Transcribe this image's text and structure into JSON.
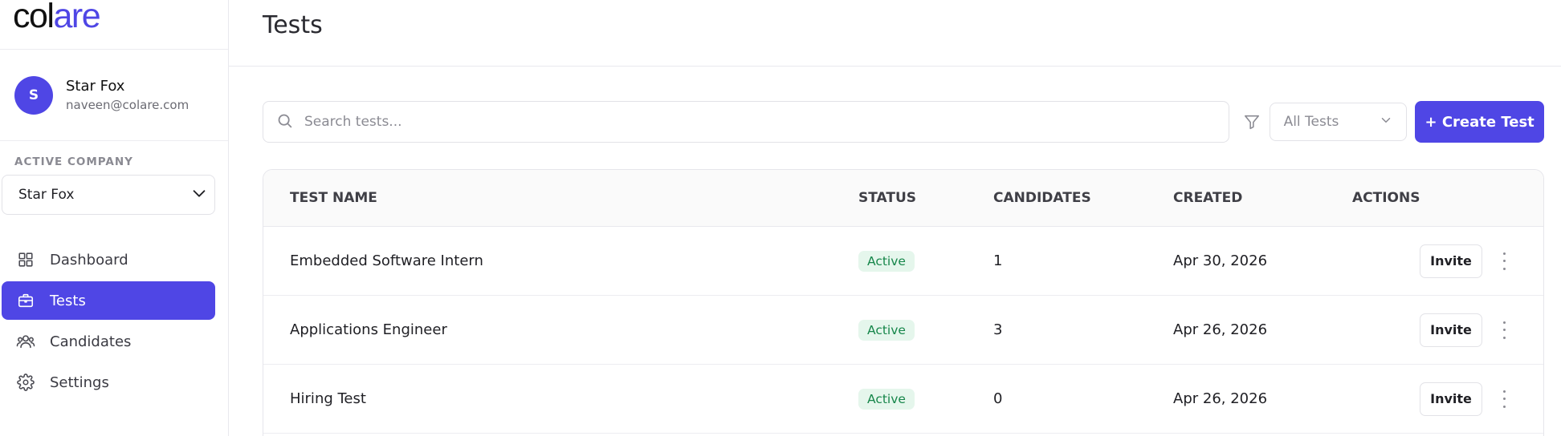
{
  "brand": {
    "logo_prefix": "col",
    "logo_accent": "are",
    "accent_color": "#4f46e5"
  },
  "user": {
    "initial": "S",
    "name": "Star Fox",
    "email": "naveen@colare.com"
  },
  "company": {
    "label": "ACTIVE COMPANY",
    "selected": "Star Fox"
  },
  "nav": {
    "items": [
      {
        "label": "Dashboard",
        "icon": "grid-icon",
        "active": false
      },
      {
        "label": "Tests",
        "icon": "briefcase-icon",
        "active": true
      },
      {
        "label": "Candidates",
        "icon": "users-icon",
        "active": false
      },
      {
        "label": "Settings",
        "icon": "gear-icon",
        "active": false
      }
    ]
  },
  "page": {
    "title": "Tests"
  },
  "toolbar": {
    "search_placeholder": "Search tests...",
    "filter_selected": "All Tests",
    "create_label": "+ Create Test"
  },
  "table": {
    "headers": {
      "name": "TEST NAME",
      "status": "STATUS",
      "candidates": "CANDIDATES",
      "created": "CREATED",
      "actions": "ACTIONS"
    },
    "rows": [
      {
        "name": "Embedded Software Intern",
        "status": "Active",
        "candidates": "1",
        "created": "Apr 30, 2026",
        "action": "Invite"
      },
      {
        "name": "Applications Engineer",
        "status": "Active",
        "candidates": "3",
        "created": "Apr 26, 2026",
        "action": "Invite"
      },
      {
        "name": "Hiring Test",
        "status": "Active",
        "candidates": "0",
        "created": "Apr 26, 2026",
        "action": "Invite"
      }
    ]
  }
}
